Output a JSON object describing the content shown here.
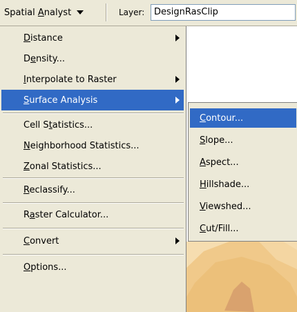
{
  "toolbar": {
    "spatial_analyst": [
      "Spatial ",
      "A",
      "nalyst"
    ],
    "layer_label": "Layer:",
    "layer_value": "DesignRasClip"
  },
  "menu": {
    "items": [
      {
        "pre": "",
        "u": "D",
        "post": "istance",
        "submenu": true
      },
      {
        "pre": "D",
        "u": "e",
        "post": "nsity...",
        "submenu": false
      },
      {
        "pre": "",
        "u": "I",
        "post": "nterpolate to Raster",
        "submenu": true
      },
      {
        "pre": "",
        "u": "S",
        "post": "urface Analysis",
        "submenu": true
      },
      {
        "pre": "Cell S",
        "u": "t",
        "post": "atistics...",
        "submenu": false
      },
      {
        "pre": "",
        "u": "N",
        "post": "eighborhood Statistics...",
        "submenu": false
      },
      {
        "pre": "",
        "u": "Z",
        "post": "onal Statistics...",
        "submenu": false
      },
      {
        "pre": "",
        "u": "R",
        "post": "eclassify...",
        "submenu": false
      },
      {
        "pre": "R",
        "u": "a",
        "post": "ster Calculator...",
        "submenu": false
      },
      {
        "pre": "",
        "u": "C",
        "post": "onvert",
        "submenu": true
      },
      {
        "pre": "",
        "u": "O",
        "post": "ptions...",
        "submenu": false
      }
    ],
    "highlighted": "Surface Analysis"
  },
  "submenu": {
    "items": [
      {
        "pre": "",
        "u": "C",
        "post": "ontour..."
      },
      {
        "pre": "",
        "u": "S",
        "post": "lope..."
      },
      {
        "pre": "",
        "u": "A",
        "post": "spect..."
      },
      {
        "pre": "",
        "u": "H",
        "post": "illshade..."
      },
      {
        "pre": "",
        "u": "V",
        "post": "iewshed..."
      },
      {
        "pre": "",
        "u": "C",
        "post": "ut/Fill..."
      }
    ],
    "highlighted": "Contour..."
  },
  "colors": {
    "highlight": "#316ac5",
    "menu_bg": "#ece9d8",
    "map_tan": "#f0c98a",
    "map_light": "#f6ddb0",
    "map_brown": "#d9a26e"
  }
}
